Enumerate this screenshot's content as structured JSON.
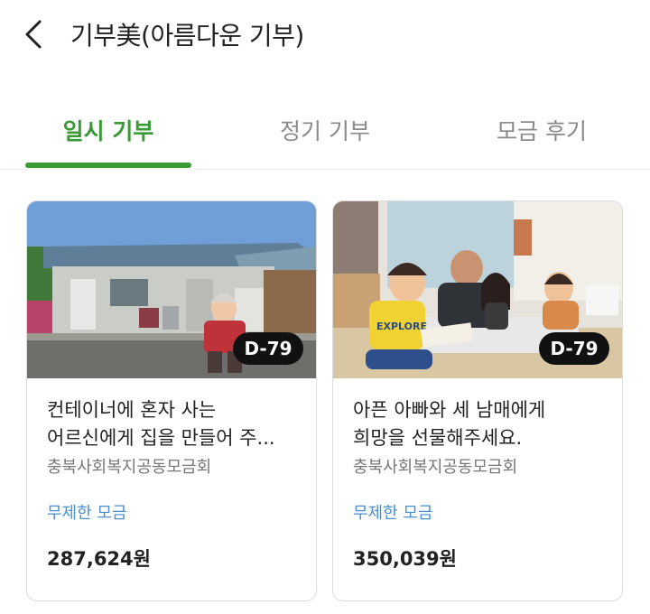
{
  "header": {
    "title": "기부美(아름다운 기부)",
    "back_icon": "chevron-left-icon"
  },
  "tabs": [
    {
      "label": "일시 기부",
      "active": true
    },
    {
      "label": "정기 기부",
      "active": false
    },
    {
      "label": "모금 후기",
      "active": false
    }
  ],
  "colors": {
    "accent": "#3a9a35",
    "tag": "#4a8fd0",
    "badge_bg": "#111111"
  },
  "cards": [
    {
      "dday": "D-79",
      "title_line1": "컨테이너에 혼자 사는",
      "title_line2": "어르신에게 집을 만들어 주...",
      "org": "충북사회복지공동모금회",
      "tag": "무제한 모금",
      "amount": "287,624원"
    },
    {
      "dday": "D-79",
      "title_line1": "아픈 아빠와 세 남매에게",
      "title_line2": "희망을 선물해주세요.",
      "org": "충북사회복지공동모금회",
      "tag": "무제한 모금",
      "amount": "350,039원",
      "shirt_text": "EXPLORE"
    }
  ]
}
